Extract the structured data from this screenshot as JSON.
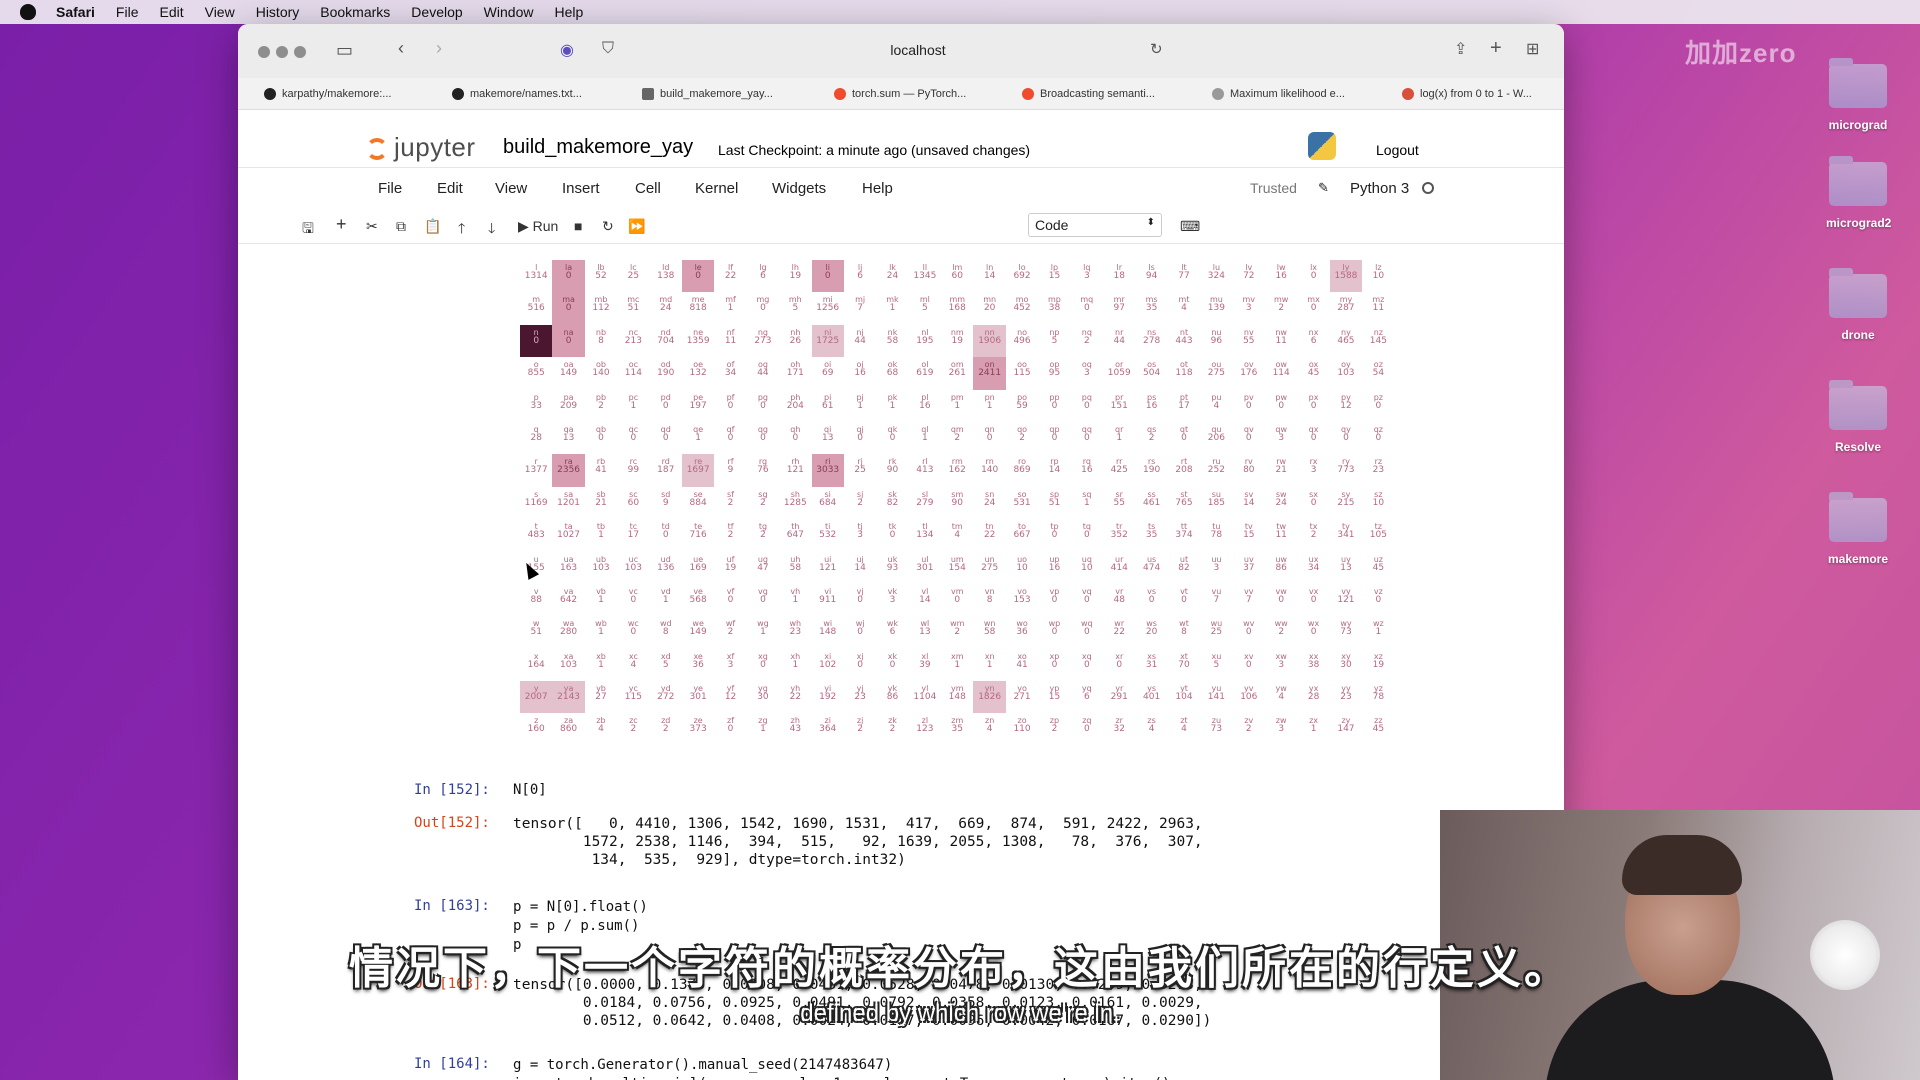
{
  "macos": {
    "menu": [
      "Safari",
      "File",
      "Edit",
      "View",
      "History",
      "Bookmarks",
      "Develop",
      "Window",
      "Help"
    ]
  },
  "desktop": {
    "watermark": "加加zero",
    "folders": [
      "micrograd",
      "micrograd2",
      "drone",
      "Resolve",
      "makemore"
    ]
  },
  "browser": {
    "address": "localhost",
    "bookmarks": [
      "karpathy/makemore:...",
      "makemore/names.txt...",
      "build_makemore_yay...",
      "torch.sum — PyTorch...",
      "Broadcasting semanti...",
      "Maximum likelihood e...",
      "log(x) from 0 to 1 - W..."
    ]
  },
  "jupyter": {
    "logo": "jupyter",
    "notebook_title": "build_makemore_yay",
    "checkpoint": "Last Checkpoint: a minute ago  (unsaved changes)",
    "logout": "Logout",
    "menus": [
      "File",
      "Edit",
      "View",
      "Insert",
      "Cell",
      "Kernel",
      "Widgets",
      "Help"
    ],
    "trusted": "Trusted",
    "kernel": "Python 3",
    "run_label": "Run",
    "cell_type": "Code"
  },
  "grid_labels": "abcdefghijklmnopqrstuvwxyz",
  "grid_rows": [
    {
      "ch": "l",
      "counts": [
        1314,
        0,
        52,
        25,
        138,
        0,
        22,
        6,
        19,
        0,
        6,
        24,
        1345,
        60,
        14,
        692,
        15,
        3,
        18,
        94,
        77,
        324,
        72,
        16,
        0,
        1588,
        10
      ],
      "hi": {
        "1": 2,
        "5": 2,
        "9": 2,
        "25": 1
      }
    },
    {
      "ch": "m",
      "counts": [
        516,
        0,
        112,
        51,
        24,
        818,
        1,
        0,
        5,
        1256,
        7,
        1,
        5,
        168,
        20,
        452,
        38,
        0,
        97,
        35,
        4,
        139,
        3,
        2,
        0,
        287,
        11
      ],
      "hi": {
        "1": 2
      }
    },
    {
      "ch": "n",
      "counts": [
        0,
        0,
        8,
        213,
        704,
        1359,
        11,
        273,
        26,
        1725,
        44,
        58,
        195,
        19,
        1906,
        496,
        5,
        2,
        44,
        278,
        443,
        96,
        55,
        11,
        6,
        465,
        145
      ],
      "hi": {
        "0": 4,
        "1": 2,
        "9": 1,
        "14": 1
      }
    },
    {
      "ch": "o",
      "counts": [
        855,
        149,
        140,
        114,
        190,
        132,
        34,
        44,
        171,
        69,
        16,
        68,
        619,
        261,
        2411,
        115,
        95,
        3,
        1059,
        504,
        118,
        275,
        176,
        114,
        45,
        103,
        54
      ],
      "hi": {
        "14": 2
      }
    },
    {
      "ch": "p",
      "counts": [
        33,
        209,
        2,
        1,
        0,
        197,
        0,
        0,
        204,
        61,
        1,
        1,
        16,
        1,
        1,
        59,
        0,
        0,
        151,
        16,
        17,
        4,
        0,
        0,
        0,
        12,
        0
      ],
      "hi": {}
    },
    {
      "ch": "q",
      "counts": [
        28,
        13,
        0,
        0,
        0,
        1,
        0,
        0,
        0,
        13,
        0,
        0,
        1,
        2,
        0,
        2,
        0,
        0,
        1,
        2,
        0,
        206,
        0,
        3,
        0,
        0,
        0
      ],
      "hi": {}
    },
    {
      "ch": "r",
      "counts": [
        1377,
        2356,
        41,
        99,
        187,
        1697,
        9,
        76,
        121,
        3033,
        25,
        90,
        413,
        162,
        140,
        869,
        14,
        16,
        425,
        190,
        208,
        252,
        80,
        21,
        3,
        773,
        23
      ],
      "hi": {
        "1": 2,
        "5": 1,
        "9": 2
      }
    },
    {
      "ch": "s",
      "counts": [
        1169,
        1201,
        21,
        60,
        9,
        884,
        2,
        2,
        1285,
        684,
        2,
        82,
        279,
        90,
        24,
        531,
        51,
        1,
        55,
        461,
        765,
        185,
        14,
        24,
        0,
        215,
        10
      ],
      "hi": {}
    },
    {
      "ch": "t",
      "counts": [
        483,
        1027,
        1,
        17,
        0,
        716,
        2,
        2,
        647,
        532,
        3,
        0,
        134,
        4,
        22,
        667,
        0,
        0,
        352,
        35,
        374,
        78,
        15,
        11,
        2,
        341,
        105
      ],
      "hi": {}
    },
    {
      "ch": "u",
      "counts": [
        155,
        163,
        103,
        103,
        136,
        169,
        19,
        47,
        58,
        121,
        14,
        93,
        301,
        154,
        275,
        10,
        16,
        10,
        414,
        474,
        82,
        3,
        37,
        86,
        34,
        13,
        45
      ],
      "hi": {}
    },
    {
      "ch": "v",
      "counts": [
        88,
        642,
        1,
        0,
        1,
        568,
        0,
        0,
        1,
        911,
        0,
        3,
        14,
        0,
        8,
        153,
        0,
        0,
        48,
        0,
        0,
        7,
        7,
        0,
        0,
        121,
        0
      ],
      "hi": {}
    },
    {
      "ch": "w",
      "counts": [
        51,
        280,
        1,
        0,
        8,
        149,
        2,
        1,
        23,
        148,
        0,
        6,
        13,
        2,
        58,
        36,
        0,
        0,
        22,
        20,
        8,
        25,
        0,
        2,
        0,
        73,
        1
      ],
      "hi": {}
    },
    {
      "ch": "x",
      "counts": [
        164,
        103,
        1,
        4,
        5,
        36,
        3,
        0,
        1,
        102,
        0,
        0,
        39,
        1,
        1,
        41,
        0,
        0,
        0,
        31,
        70,
        5,
        0,
        3,
        38,
        30,
        19
      ],
      "hi": {}
    },
    {
      "ch": "y",
      "counts": [
        2007,
        2143,
        27,
        115,
        272,
        301,
        12,
        30,
        22,
        192,
        23,
        86,
        1104,
        148,
        1826,
        271,
        15,
        6,
        291,
        401,
        104,
        141,
        106,
        4,
        28,
        23,
        78
      ],
      "hi": {
        "0": 1,
        "1": 1,
        "14": 1
      }
    },
    {
      "ch": "z",
      "counts": [
        160,
        860,
        4,
        2,
        2,
        373,
        0,
        1,
        43,
        364,
        2,
        2,
        123,
        35,
        4,
        110,
        2,
        0,
        32,
        4,
        4,
        73,
        2,
        3,
        1,
        147,
        45
      ],
      "hi": {}
    }
  ],
  "cells": [
    {
      "prompt": "In [152]:",
      "code": "N[0]"
    },
    {
      "prompt": "Out[152]:",
      "text": "tensor([   0, 4410, 1306, 1542, 1690, 1531,  417,  669,  874,  591, 2422, 2963,\n        1572, 2538, 1146,  394,  515,   92, 1639, 2055, 1308,   78,  376,  307,\n         134,  535,  929], dtype=torch.int32)"
    },
    {
      "prompt": "In [163]:",
      "code": "p = N[0].float()\np = p / p.sum()\np"
    },
    {
      "prompt": "Out[163]:",
      "text": "tensor([0.0000, 0.1377, 0.0408, 0.0481, 0.0528, 0.0478, 0.0130, 0.0209, 0.0273,\n        0.0184, 0.0756, 0.0925, 0.0491, 0.0792, 0.0358, 0.0123, 0.0161, 0.0029,\n        0.0512, 0.0642, 0.0408, 0.0024, 0.0117, 0.0096, 0.0042, 0.0167, 0.0290])"
    },
    {
      "prompt": "In [164]:",
      "code": "g = torch.Generator().manual_seed(2147483647)\nix = torch.multinomial(p, num_samples=1, replacement=True, generator=g).item()"
    }
  ],
  "subtitle": {
    "zh": "情况下，下一个字符的概率分布，这由我们所在的行定义。",
    "en": "defined by which row we're in."
  }
}
